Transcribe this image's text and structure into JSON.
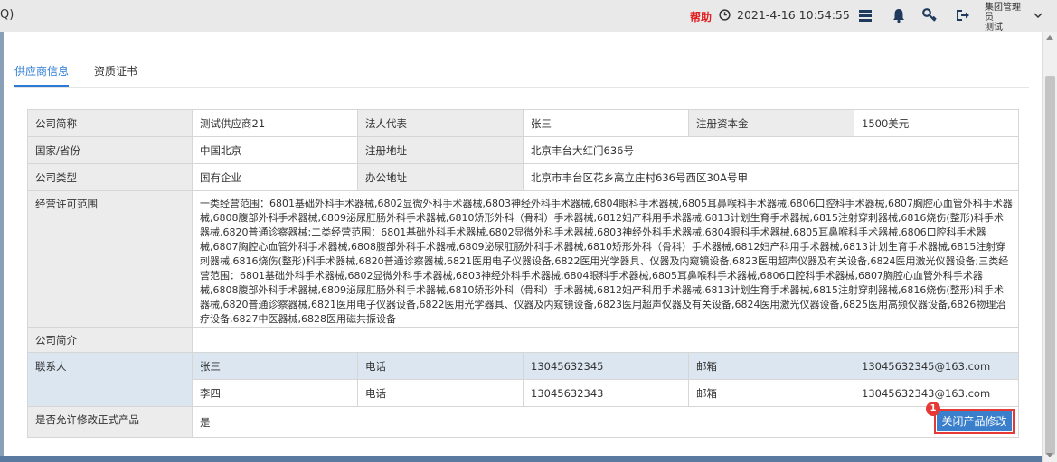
{
  "topbar": {
    "partial_title": "Q)",
    "help": "帮助",
    "datetime": "2021-4-16  10:54:55",
    "user": "集团管理员\n测试",
    "icons": [
      "clock-icon",
      "list-icon",
      "bell-icon",
      "key-icon",
      "logout-icon",
      "chevron-down-icon"
    ]
  },
  "tabs": [
    {
      "label": "供应商信息",
      "active": true
    },
    {
      "label": "资质证书",
      "active": false
    }
  ],
  "fields": {
    "company_short_label": "公司简称",
    "company_short_value": "测试供应商21",
    "legal_rep_label": "法人代表",
    "legal_rep_value": "张三",
    "reg_capital_label": "注册资本金",
    "reg_capital_value": "1500美元",
    "country_label": "国家/省份",
    "country_value": "中国北京",
    "reg_addr_label": "注册地址",
    "reg_addr_value": "北京丰台大红门636号",
    "company_type_label": "公司类型",
    "company_type_value": "国有企业",
    "office_addr_label": "办公地址",
    "office_addr_value": "北京市丰台区花乡高立庄村636号西区30A号甲",
    "scope_label": "经营许可范围",
    "scope_value": "一类经营范围：6801基础外科手术器械,6802显微外科手术器械,6803神经外科手术器械,6804眼科手术器械,6805耳鼻喉科手术器械,6806口腔科手术器械,6807胸腔心血管外科手术器械,6808腹部外科手术器械,6809泌尿肛肠外科手术器械,6810矫形外科（骨科）手术器械,6812妇产科用手术器械,6813计划生育手术器械,6815注射穿刺器械,6816烧伤(整形)科手术器械,6820普通诊察器械;二类经营范围：6801基础外科手术器械,6802显微外科手术器械,6803神经外科手术器械,6804眼科手术器械,6805耳鼻喉科手术器械,6806口腔科手术器械,6807胸腔心血管外科手术器械,6808腹部外科手术器械,6809泌尿肛肠外科手术器械,6810矫形外科（骨科）手术器械,6812妇产科用手术器械,6813计划生育手术器械,6815注射穿刺器械,6816烧伤(整形)科手术器械,6820普通诊察器械,6821医用电子仪器设备,6822医用光学器具、仪器及内窥镜设备,6823医用超声仪器及有关设备,6824医用激光仪器设备;三类经营范围：6801基础外科手术器械,6802显微外科手术器械,6803神经外科手术器械,6804眼科手术器械,6805耳鼻喉科手术器械,6806口腔科手术器械,6807胸腔心血管外科手术器械,6808腹部外科手术器械,6809泌尿肛肠外科手术器械,6810矫形外科（骨科）手术器械,6812妇产科用手术器械,6813计划生育手术器械,6815注射穿刺器械,6816烧伤(整形)科手术器械,6820普通诊察器械,6821医用电子仪器设备,6822医用光学器具、仪器及内窥镜设备,6823医用超声仪器及有关设备,6824医用激光仪器设备,6825医用高频仪器设备,6826物理治疗设备,6827中医器械,6828医用磁共振设备",
    "intro_label": "公司简介",
    "intro_value": "",
    "contact_label": "联系人",
    "allow_label": "是否允许修改正式产品",
    "allow_value": "是"
  },
  "contacts": [
    {
      "name": "张三",
      "phone_label": "电话",
      "phone": "13045632345",
      "email_label": "邮箱",
      "email": "13045632345@163.com"
    },
    {
      "name": "李四",
      "phone_label": "电话",
      "phone": "13045632343",
      "email_label": "邮箱",
      "email": "13045632343@163.com"
    }
  ],
  "actions": {
    "close_edit_label": "关闭产品修改",
    "badge": "1"
  },
  "colors": {
    "accent": "#2b7ad6",
    "help_red": "#e02020",
    "button_blue": "#3a7fcb",
    "highlight_red": "#e53935",
    "contact_row_bg": "#dbe6f1"
  }
}
